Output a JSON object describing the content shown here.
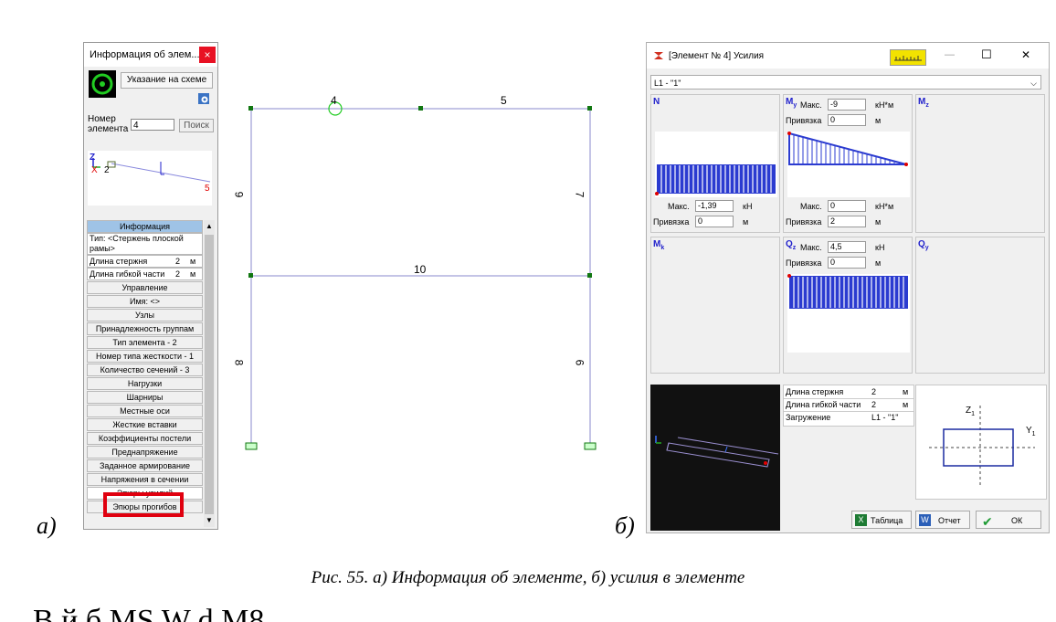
{
  "info_panel": {
    "title": "Информация об элем...",
    "close": "×",
    "point_button": "Указание на схеме",
    "number_label": "Номер элемента",
    "number_value": "4",
    "search_button": "Поиск",
    "preview_node_left": "2",
    "preview_node_right": "5",
    "preview_axis_x": "X",
    "preview_axis_z": "Z",
    "info_header": "Информация",
    "type_text": "Тип: <Стержень плоской рамы>",
    "rod_length_label": "Длина стержня",
    "rod_length_value": "2",
    "flex_length_label": "Длина гибкой части",
    "flex_length_value": "2",
    "unit_m": "м",
    "menu": [
      "Управление",
      "Имя: <>",
      "Узлы",
      "Принадлежность группам",
      "Тип элемента - 2",
      "Номер типа жесткости - 1",
      "Количество сечений - 3",
      "Нагрузки",
      "Шарниры",
      "Местные оси",
      "Жесткие вставки",
      "Коэффициенты постели",
      "Преднапряжение",
      "Заданное армирование",
      "Напряжения в сечении",
      "Эпюры усилий",
      "Эпюры прогибов"
    ]
  },
  "label_a": "а)",
  "label_b": "б)",
  "frame": {
    "labels": {
      "top_left": "4",
      "top_right": "5",
      "mid": "10",
      "left_upper": "9",
      "left_lower": "8",
      "right_upper": "7",
      "right_lower": "6"
    }
  },
  "window": {
    "title": "[Элемент № 4] Усилия",
    "minimize": "—",
    "maximize": "☐",
    "close": "✕",
    "combo": "L1 - \"1\"",
    "max_label": "Макс.",
    "bind_label": "Привязка",
    "N": {
      "axis": "N",
      "max": "-1,39",
      "unit": "кН",
      "bind": "0",
      "bind_unit": "м"
    },
    "My": {
      "axis": "M",
      "sub": "y",
      "max": "-9",
      "unit": "кН*м",
      "bind": "0",
      "bind_unit": "м",
      "max2": "0",
      "unit2": "кН*м",
      "bind2": "2",
      "bind2_unit": "м"
    },
    "Mz": {
      "axis": "M",
      "sub": "z"
    },
    "Mk": {
      "axis": "M",
      "sub": "k"
    },
    "Qz": {
      "axis": "Q",
      "sub": "z",
      "max": "4,5",
      "unit": "кН",
      "bind": "0",
      "bind_unit": "м"
    },
    "Qy": {
      "axis": "Q",
      "sub": "y"
    },
    "props": [
      {
        "label": "Длина стержня",
        "value": "2",
        "unit": "м"
      },
      {
        "label": "Длина гибкой части",
        "value": "2",
        "unit": "м"
      },
      {
        "label": "Загружение",
        "value": "L1 - \"1\"",
        "unit": ""
      }
    ],
    "section_z": "Z",
    "section_z_sub": "1",
    "section_y": "Y",
    "section_y_sub": "1",
    "btn_table": "Таблица",
    "btn_report": "Отчет",
    "btn_ok": "ОК"
  },
  "caption": "Рис. 55. а) Информация об элементе, б) усилия в элементе",
  "bottom_text": "В                                                      й                         б     MS W  d      M8"
}
